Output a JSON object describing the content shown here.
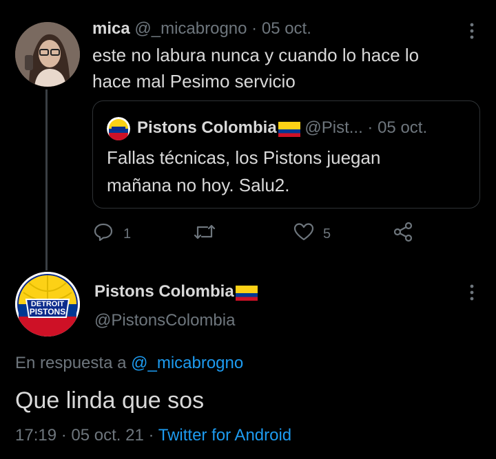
{
  "reply_tweet": {
    "author_name": "mica",
    "author_handle": "@_micabrogno",
    "separator": "·",
    "date": "05 oct.",
    "text_line1": "este no labura nunca y cuando lo hace lo",
    "text_line2": "hace mal Pesimo servicio"
  },
  "quoted_tweet": {
    "author_name": "Pistons Colombia",
    "author_handle": "@Pist...",
    "separator": "·",
    "date": "05 oct.",
    "text_line1": "Fallas técnicas, los Pistons juegan",
    "text_line2": "mañana no hoy. Salu2."
  },
  "actions": {
    "reply_count": "1",
    "retweet_count": "",
    "like_count": "5"
  },
  "main_tweet": {
    "author_name": "Pistons Colombia",
    "author_handle": "@PistonsColombia",
    "reply_prefix": "En respuesta a",
    "reply_to": "@_micabrogno",
    "text": "Que linda que sos",
    "time": "17:19",
    "separator1": "·",
    "date": "05 oct. 21",
    "separator2": "·",
    "client": "Twitter for Android",
    "logo_text_top": "DETROIT",
    "logo_text_bottom": "PISTONS"
  },
  "colors": {
    "background": "#000000",
    "text": "#d9d9d9",
    "muted": "#6e767d",
    "link": "#1d9bf0",
    "flag_yellow": "#fcd116",
    "flag_blue": "#003893",
    "flag_red": "#ce1126"
  },
  "icons": [
    "more-icon",
    "reply-icon",
    "retweet-icon",
    "like-icon",
    "share-icon",
    "colombia-flag-icon"
  ]
}
